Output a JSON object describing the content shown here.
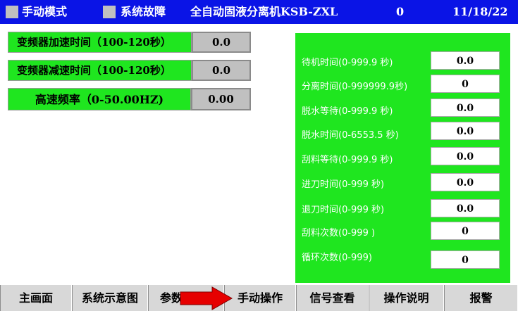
{
  "header": {
    "manual_mode_label": "手动模式",
    "system_fault_label": "系统故障",
    "machine_title": "全自动固液分离机KSB-ZXL",
    "counter": "0",
    "date": "11/18/22"
  },
  "left_params": [
    {
      "label": "变频器加速时间（100-120秒）",
      "value": "0.0"
    },
    {
      "label": "变频器减速时间（100-120秒）",
      "value": "0.0"
    },
    {
      "label": "高速频率（0-50.00HZ)",
      "value": "0.00"
    }
  ],
  "timers": [
    {
      "label": "待机时间(0-999.9 秒)",
      "value": "0.0"
    },
    {
      "label": "分离时间(0-999999.9秒)",
      "value": "0"
    },
    {
      "label": "脱水等待(0-999.9 秒)",
      "value": "0.0"
    },
    {
      "label": "脱水时间(0-6553.5 秒)",
      "value": "0.0"
    },
    {
      "label": "刮料等待(0-999.9 秒)",
      "value": "0.0"
    },
    {
      "label": "进刀时间(0-999 秒)",
      "value": "0.0"
    },
    {
      "label": "退刀时间(0-999 秒)",
      "value": "0.0"
    },
    {
      "label": "刮料次数(0-999 )",
      "value": "0"
    },
    {
      "label": "循环次数(0-999)",
      "value": "0"
    }
  ],
  "nav": {
    "main": "主画面",
    "diagram": "系统示意图",
    "params": "参数",
    "manual": "手动操作",
    "signals": "信号查看",
    "manual_doc": "操作说明",
    "alarm": "报警"
  },
  "colors": {
    "header_blue": "#0a14e6",
    "green": "#1fe61f",
    "grey": "#c0c0c0",
    "arrow_red": "#e60000"
  }
}
